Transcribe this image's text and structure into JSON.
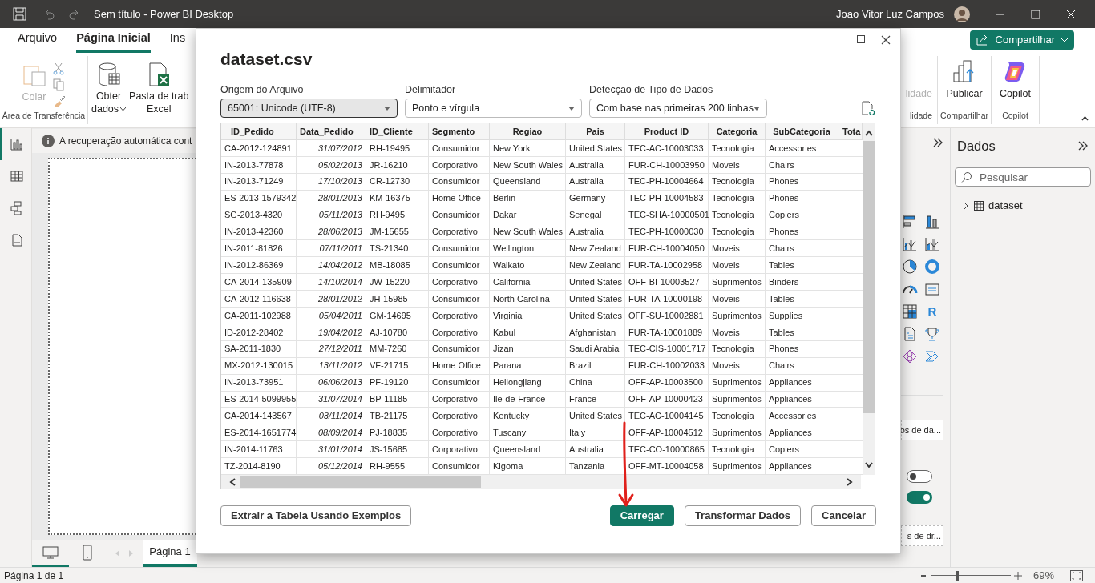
{
  "window": {
    "title": "Sem título - Power BI Desktop",
    "user": "Joao Vitor Luz Campos"
  },
  "ribbon": {
    "tabs": [
      {
        "label": "Arquivo",
        "selected": false
      },
      {
        "label": "Página Inicial",
        "selected": true
      },
      {
        "label": "Ins",
        "selected": false
      }
    ],
    "share_button": "Compartilhar",
    "clipboard": {
      "paste": "Colar",
      "disabled": true,
      "group": "Área de Transferência"
    },
    "data_buttons": [
      {
        "lines": [
          "Obter",
          "dados"
        ],
        "kind": "dropdown"
      },
      {
        "lines": [
          "Pasta de trab",
          "Excel"
        ],
        "kind": "excel"
      }
    ],
    "right_groups": [
      {
        "button": "lidade",
        "group": "lidade",
        "disabled": true,
        "kind": "faded"
      },
      {
        "button": "Publicar",
        "group": "Compartilhar",
        "disabled": false,
        "kind": "publish"
      },
      {
        "button": "Copilot",
        "group": "Copilot",
        "disabled": false,
        "kind": "copilot"
      }
    ]
  },
  "left_rail": [
    {
      "kind": "report",
      "selected": true
    },
    {
      "kind": "table",
      "selected": false
    },
    {
      "kind": "model",
      "selected": false
    },
    {
      "kind": "dax",
      "selected": false
    }
  ],
  "info_bar": {
    "message": "A recuperação automática cont"
  },
  "layout_views": [
    {
      "kind": "desktop",
      "selected": true
    },
    {
      "kind": "phone",
      "selected": false
    }
  ],
  "page_tabs": [
    {
      "label": "Página 1",
      "selected": true
    }
  ],
  "visualizations": {
    "script_glyph": "R",
    "wells": [
      "os de da...",
      "s de dr..."
    ],
    "toggles": [
      {
        "on": false
      },
      {
        "on": true
      }
    ]
  },
  "data_pane": {
    "title": "Dados",
    "search_placeholder": "Pesquisar",
    "tables": [
      {
        "name": "dataset",
        "expanded": false
      }
    ]
  },
  "status_bar": {
    "page": "Página 1 de 1",
    "zoom": {
      "label": "69%",
      "level": 0.33
    }
  },
  "dialog": {
    "title": "dataset.csv",
    "fields": [
      {
        "label": "Origem do Arquivo",
        "value": "65001: Unicode (UTF-8)",
        "focused": true
      },
      {
        "label": "Delimitador",
        "value": "Ponto e vírgula",
        "focused": false
      },
      {
        "label": "Detecção de Tipo de Dados",
        "value": "Com base nas primeiras 200 linhas",
        "focused": false
      }
    ],
    "columns": [
      {
        "name": "ID_Pedido",
        "kind": "text"
      },
      {
        "name": "Data_Pedido",
        "kind": "date"
      },
      {
        "name": "ID_Cliente",
        "kind": "text"
      },
      {
        "name": "Segmento",
        "kind": "text"
      },
      {
        "name": "Regiao",
        "kind": "text"
      },
      {
        "name": "Pais",
        "kind": "text"
      },
      {
        "name": "Product ID",
        "kind": "text"
      },
      {
        "name": "Categoria",
        "kind": "text"
      },
      {
        "name": "SubCategoria",
        "kind": "text"
      },
      {
        "name": "Tota",
        "kind": "cut"
      }
    ],
    "rows": [
      [
        "CA-2012-124891",
        "31/07/2012",
        "RH-19495",
        "Consumidor",
        "New York",
        "United States",
        "TEC-AC-10003033",
        "Tecnologia",
        "Accessories"
      ],
      [
        "IN-2013-77878",
        "05/02/2013",
        "JR-16210",
        "Corporativo",
        "New South Wales",
        "Australia",
        "FUR-CH-10003950",
        "Moveis",
        "Chairs"
      ],
      [
        "IN-2013-71249",
        "17/10/2013",
        "CR-12730",
        "Consumidor",
        "Queensland",
        "Australia",
        "TEC-PH-10004664",
        "Tecnologia",
        "Phones"
      ],
      [
        "ES-2013-1579342",
        "28/01/2013",
        "KM-16375",
        "Home Office",
        "Berlin",
        "Germany",
        "TEC-PH-10004583",
        "Tecnologia",
        "Phones"
      ],
      [
        "SG-2013-4320",
        "05/11/2013",
        "RH-9495",
        "Consumidor",
        "Dakar",
        "Senegal",
        "TEC-SHA-10000501",
        "Tecnologia",
        "Copiers"
      ],
      [
        "IN-2013-42360",
        "28/06/2013",
        "JM-15655",
        "Corporativo",
        "New South Wales",
        "Australia",
        "TEC-PH-10000030",
        "Tecnologia",
        "Phones"
      ],
      [
        "IN-2011-81826",
        "07/11/2011",
        "TS-21340",
        "Consumidor",
        "Wellington",
        "New Zealand",
        "FUR-CH-10004050",
        "Moveis",
        "Chairs"
      ],
      [
        "IN-2012-86369",
        "14/04/2012",
        "MB-18085",
        "Consumidor",
        "Waikato",
        "New Zealand",
        "FUR-TA-10002958",
        "Moveis",
        "Tables"
      ],
      [
        "CA-2014-135909",
        "14/10/2014",
        "JW-15220",
        "Corporativo",
        "California",
        "United States",
        "OFF-BI-10003527",
        "Suprimentos",
        "Binders"
      ],
      [
        "CA-2012-116638",
        "28/01/2012",
        "JH-15985",
        "Consumidor",
        "North Carolina",
        "United States",
        "FUR-TA-10000198",
        "Moveis",
        "Tables"
      ],
      [
        "CA-2011-102988",
        "05/04/2011",
        "GM-14695",
        "Corporativo",
        "Virginia",
        "United States",
        "OFF-SU-10002881",
        "Suprimentos",
        "Supplies"
      ],
      [
        "ID-2012-28402",
        "19/04/2012",
        "AJ-10780",
        "Corporativo",
        "Kabul",
        "Afghanistan",
        "FUR-TA-10001889",
        "Moveis",
        "Tables"
      ],
      [
        "SA-2011-1830",
        "27/12/2011",
        "MM-7260",
        "Consumidor",
        "Jizan",
        "Saudi Arabia",
        "TEC-CIS-10001717",
        "Tecnologia",
        "Phones"
      ],
      [
        "MX-2012-130015",
        "13/11/2012",
        "VF-21715",
        "Home Office",
        "Parana",
        "Brazil",
        "FUR-CH-10002033",
        "Moveis",
        "Chairs"
      ],
      [
        "IN-2013-73951",
        "06/06/2013",
        "PF-19120",
        "Consumidor",
        "Heilongjiang",
        "China",
        "OFF-AP-10003500",
        "Suprimentos",
        "Appliances"
      ],
      [
        "ES-2014-5099955",
        "31/07/2014",
        "BP-11185",
        "Corporativo",
        "Ile-de-France",
        "France",
        "OFF-AP-10000423",
        "Suprimentos",
        "Appliances"
      ],
      [
        "CA-2014-143567",
        "03/11/2014",
        "TB-21175",
        "Corporativo",
        "Kentucky",
        "United States",
        "TEC-AC-10004145",
        "Tecnologia",
        "Accessories"
      ],
      [
        "ES-2014-1651774",
        "08/09/2014",
        "PJ-18835",
        "Corporativo",
        "Tuscany",
        "Italy",
        "OFF-AP-10004512",
        "Suprimentos",
        "Appliances"
      ],
      [
        "IN-2014-11763",
        "31/01/2014",
        "JS-15685",
        "Corporativo",
        "Queensland",
        "Australia",
        "TEC-CO-10000865",
        "Tecnologia",
        "Copiers"
      ],
      [
        "TZ-2014-8190",
        "05/12/2014",
        "RH-9555",
        "Consumidor",
        "Kigoma",
        "Tanzania",
        "OFF-MT-10004058",
        "Suprimentos",
        "Appliances"
      ]
    ],
    "buttons": [
      {
        "label": "Extrair a Tabela Usando Exemplos",
        "primary": false
      },
      {
        "label": "Carregar",
        "primary": true
      },
      {
        "label": "Transformar Dados",
        "primary": false
      },
      {
        "label": "Cancelar",
        "primary": false
      }
    ]
  }
}
